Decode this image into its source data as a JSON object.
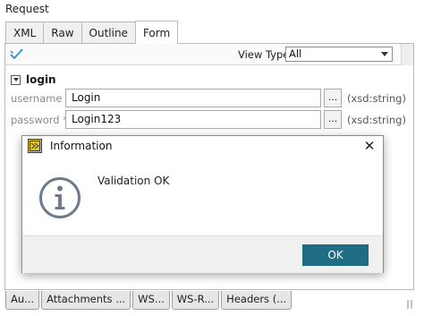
{
  "panel": {
    "title": "Request"
  },
  "tabs": [
    {
      "label": "XML"
    },
    {
      "label": "Raw"
    },
    {
      "label": "Outline"
    },
    {
      "label": "Form"
    }
  ],
  "active_tab": "Form",
  "toolbar": {
    "view_type_label": "View Type:",
    "view_type_value": "All"
  },
  "form": {
    "section_label": "login",
    "fields": [
      {
        "label": "username *:",
        "value": "Login",
        "browse": "...",
        "type": "(xsd:string)"
      },
      {
        "label": "password *:",
        "value": "Login123",
        "browse": "...",
        "type": "(xsd:string)"
      }
    ]
  },
  "bottom_tabs": [
    {
      "label": "Au..."
    },
    {
      "label": "Attachments ..."
    },
    {
      "label": "WS..."
    },
    {
      "label": "WS-R..."
    },
    {
      "label": "Headers (..."
    }
  ],
  "dialog": {
    "title": "Information",
    "close": "✕",
    "message": "Validation OK",
    "ok_label": "OK"
  },
  "colors": {
    "ok_button": "#1f6c85",
    "validate_check": "#2a8fd0",
    "info_icon": "#6e7b8a"
  },
  "icons": {
    "validate": "validate-check-icon",
    "info": "information-icon",
    "app": "soapui-app-icon",
    "close": "close-icon"
  }
}
